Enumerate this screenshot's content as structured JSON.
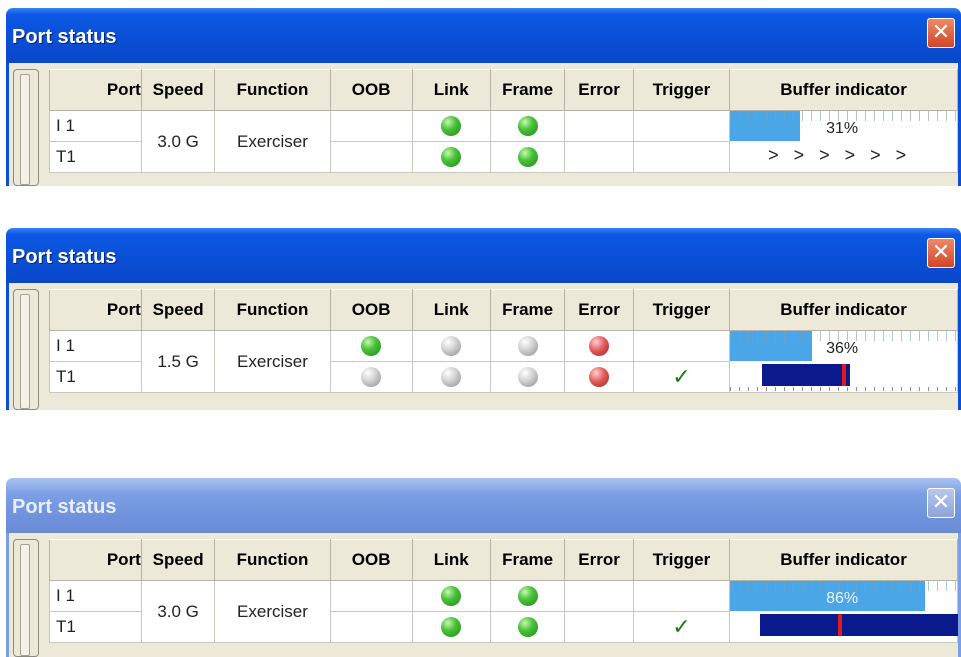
{
  "windows": [
    {
      "title": "Port status",
      "close_icon": "✕",
      "columns": [
        "Port",
        "Speed",
        "Function",
        "OOB",
        "Link",
        "Frame",
        "Error",
        "Trigger",
        "Buffer indicator"
      ],
      "ports": [
        "I 1",
        "T1"
      ],
      "speed": "3.0 G",
      "function": "Exerciser",
      "leds": {
        "oob": [
          "none",
          "none"
        ],
        "link": [
          "green",
          "green"
        ],
        "frame": [
          "green",
          "green"
        ],
        "error": [
          "none",
          "none"
        ]
      },
      "trigger": [
        "",
        ""
      ],
      "buffer": {
        "percent": 31,
        "label": "31%",
        "bottom_text": "> > > > > >",
        "fill_color": "#4aa6e6"
      }
    },
    {
      "title": "Port status",
      "close_icon": "✕",
      "columns": [
        "Port",
        "Speed",
        "Function",
        "OOB",
        "Link",
        "Frame",
        "Error",
        "Trigger",
        "Buffer indicator"
      ],
      "ports": [
        "I 1",
        "T1"
      ],
      "speed": "1.5 G",
      "function": "Exerciser",
      "leds": {
        "oob": [
          "green",
          "gray"
        ],
        "link": [
          "gray",
          "gray"
        ],
        "frame": [
          "gray",
          "gray"
        ],
        "error": [
          "red",
          "red"
        ]
      },
      "trigger": [
        "",
        "✓"
      ],
      "buffer": {
        "percent": 36,
        "label": "36%",
        "trigger_bar_color": "#0a1a8c",
        "trigger_mark_color": "#e01a1a"
      }
    },
    {
      "title": "Port status",
      "close_icon": "✕",
      "columns": [
        "Port",
        "Speed",
        "Function",
        "OOB",
        "Link",
        "Frame",
        "Error",
        "Trigger",
        "Buffer indicator"
      ],
      "ports": [
        "I 1",
        "T1"
      ],
      "speed": "3.0 G",
      "function": "Exerciser",
      "leds": {
        "oob": [
          "none",
          "none"
        ],
        "link": [
          "green",
          "green"
        ],
        "frame": [
          "green",
          "green"
        ],
        "error": [
          "none",
          "none"
        ]
      },
      "trigger": [
        "",
        "✓"
      ],
      "buffer": {
        "percent": 86,
        "label": "86%",
        "trigger_bar_color": "#0a1a8c",
        "trigger_mark_color": "#e01a1a"
      }
    }
  ]
}
